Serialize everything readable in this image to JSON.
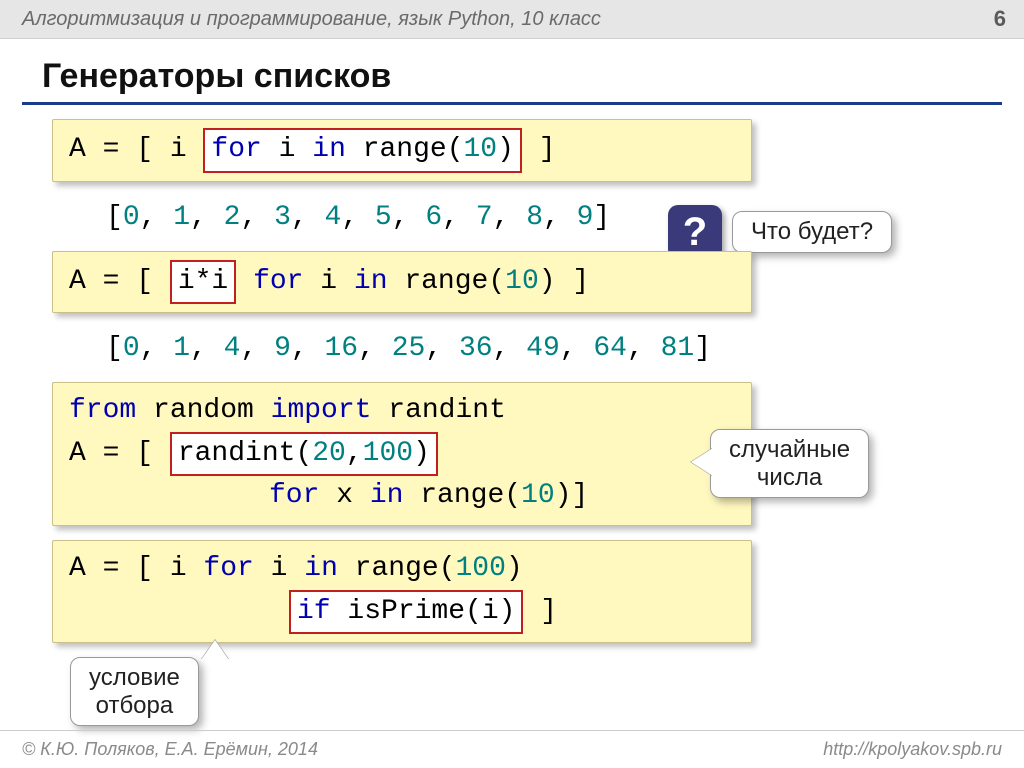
{
  "header": {
    "course": "Алгоритмизация и программирование, язык Python, 10 класс",
    "page": "6"
  },
  "title": "Генераторы списков",
  "code1": {
    "pre": "A = [ i ",
    "boxed": "for i in range(10)",
    "post": " ]"
  },
  "result1": "[0, 1, 2, 3, 4, 5, 6, 7, 8, 9]",
  "q_label": "Что будет?",
  "code2": {
    "pre": "A = [ ",
    "boxed": "i*i",
    "post": " for i in range(10) ]"
  },
  "result2": "[0, 1, 4, 9, 16, 25, 36, 49, 64, 81]",
  "code3": {
    "line1_a": "from",
    "line1_b": " random ",
    "line1_c": "import",
    "line1_d": " randint",
    "line2_pre": "A = [ ",
    "line2_box": "randint(20,100)",
    "line3": "for x in range(10)]"
  },
  "callout_random": "случайные\nчисла",
  "code4": {
    "line1": "A = [ i for i in range(100)",
    "line2_box": "if isPrime(i)",
    "line2_post": " ]"
  },
  "callout_filter": "условие\nотбора",
  "footer": {
    "left": "© К.Ю. Поляков, Е.А. Ерёмин, 2014",
    "right": "http://kpolyakov.spb.ru"
  }
}
